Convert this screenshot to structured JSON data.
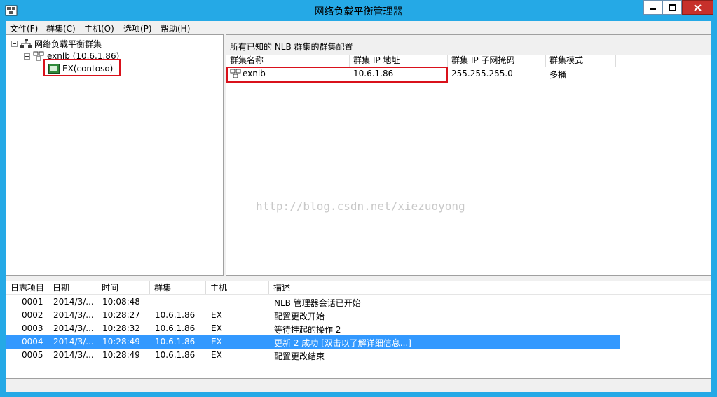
{
  "window": {
    "title": "网络负载平衡管理器"
  },
  "menu": [
    "文件(F)",
    "群集(C)",
    "主机(O)",
    "选项(P)",
    "帮助(H)"
  ],
  "tree": {
    "root": "网络负载平衡群集",
    "cluster": "exnlb (10.6.1.86)",
    "host": "EX(contoso)"
  },
  "cluster_list": {
    "caption": "所有已知的 NLB 群集的群集配置",
    "columns": [
      "群集名称",
      "群集 IP 地址",
      "群集 IP 子网掩码",
      "群集模式"
    ],
    "rows": [
      {
        "name": "exnlb",
        "ip": "10.6.1.86",
        "mask": "255.255.255.0",
        "mode": "多播"
      }
    ]
  },
  "watermark": "http://blog.csdn.net/xiezuoyong",
  "log": {
    "columns": [
      "日志项目",
      "日期",
      "时间",
      "群集",
      "主机",
      "描述"
    ],
    "rows": [
      {
        "id": "0001",
        "date": "2014/3/...",
        "time": "10:08:48",
        "cluster": "",
        "host": "",
        "desc": "NLB 管理器会话已开始"
      },
      {
        "id": "0002",
        "date": "2014/3/...",
        "time": "10:28:27",
        "cluster": "10.6.1.86",
        "host": "EX",
        "desc": "配置更改开始"
      },
      {
        "id": "0003",
        "date": "2014/3/...",
        "time": "10:28:32",
        "cluster": "10.6.1.86",
        "host": "EX",
        "desc": "等待挂起的操作 2"
      },
      {
        "id": "0004",
        "date": "2014/3/...",
        "time": "10:28:49",
        "cluster": "10.6.1.86",
        "host": "EX",
        "desc": "更新 2 成功 [双击以了解详细信息...]"
      },
      {
        "id": "0005",
        "date": "2014/3/...",
        "time": "10:28:49",
        "cluster": "10.6.1.86",
        "host": "EX",
        "desc": "配置更改结束"
      }
    ],
    "selected_index": 3
  },
  "colors": {
    "titlebar": "#25a9e6",
    "selection": "#3399ff",
    "annotation_red": "#d9111b",
    "close_button": "#c7302b"
  }
}
